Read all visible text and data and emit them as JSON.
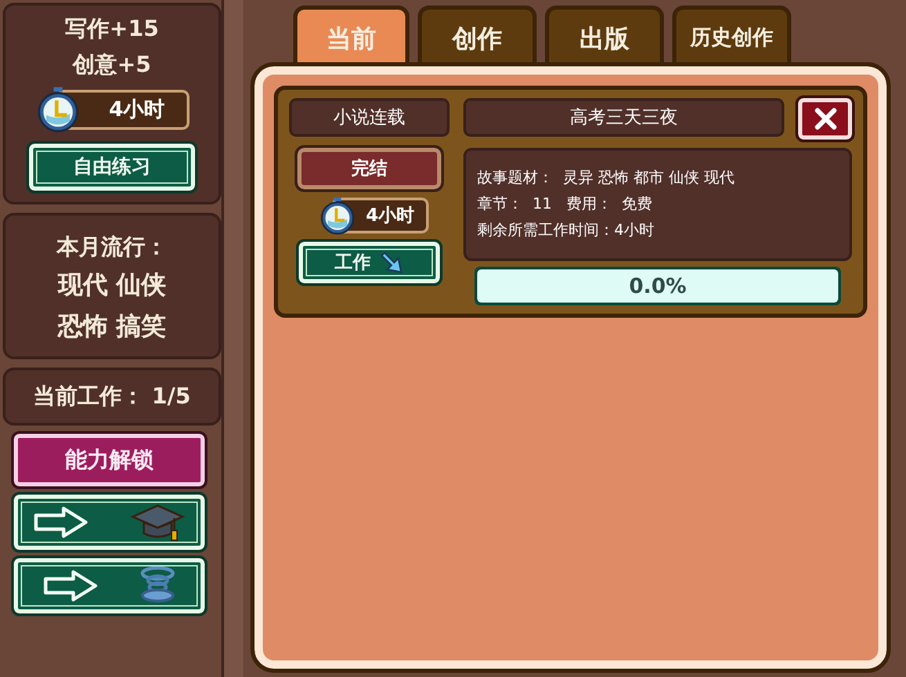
{
  "sidebar": {
    "bonus_lines": [
      "写作+15",
      "创意+5"
    ],
    "time": "4小时",
    "practice_button": "自由练习",
    "trend_title": "本月流行：",
    "trend_lines": [
      "现代 仙侠",
      "恐怖 搞笑"
    ],
    "current_work": "当前工作： 1/5",
    "unlock_button": "能力解锁",
    "nav_buttons": [
      {
        "kind": "graduation"
      },
      {
        "kind": "spring"
      }
    ]
  },
  "tabs": [
    {
      "label": "当前",
      "selected": true
    },
    {
      "label": "创作",
      "selected": false
    },
    {
      "label": "出版",
      "selected": false
    },
    {
      "label": "历史创作",
      "selected": false
    }
  ],
  "work_card": {
    "type": "小说连载",
    "title": "高考三天三夜",
    "status_button": "完结",
    "time": "4小时",
    "work_button": "工作",
    "details": [
      "故事题材：  灵异 恐怖 都市 仙侠 现代",
      "章节：  11   费用：  免费",
      "剩余所需工作时间：4小时"
    ],
    "progress": {
      "level": 0,
      "reading": "0.0%"
    }
  }
}
